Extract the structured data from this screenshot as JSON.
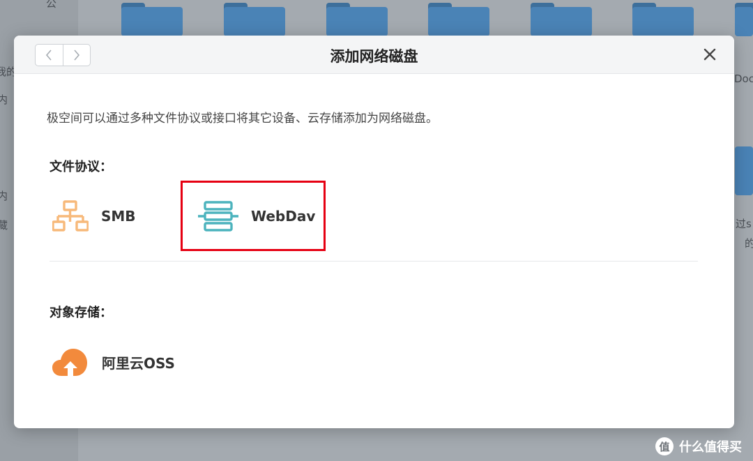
{
  "background": {
    "sidebar_fragments": [
      "公",
      "我的",
      "内",
      "内",
      "藏"
    ],
    "right_fragments": [
      "Doc",
      "过s",
      "的"
    ]
  },
  "dialog": {
    "title": "添加网络磁盘",
    "intro": "极空间可以通过多种文件协议或接口将其它设备、云存储添加为网络磁盘。",
    "file_protocol_section": {
      "label": "文件协议：",
      "options": [
        {
          "label": "SMB",
          "icon": "network-topology-icon",
          "color": "#f7b97a"
        },
        {
          "label": "WebDav",
          "icon": "server-stack-icon",
          "color": "#4cb3bd"
        }
      ]
    },
    "object_storage_section": {
      "label": "对象存储：",
      "options": [
        {
          "label": "阿里云OSS",
          "icon": "cloud-upload-icon",
          "color": "#f28a3c"
        }
      ]
    }
  },
  "watermark": {
    "logo": "值",
    "text": "什么值得买"
  },
  "colors": {
    "highlight_border": "#e60012",
    "dialog_header_bg": "#f4f5f6"
  }
}
